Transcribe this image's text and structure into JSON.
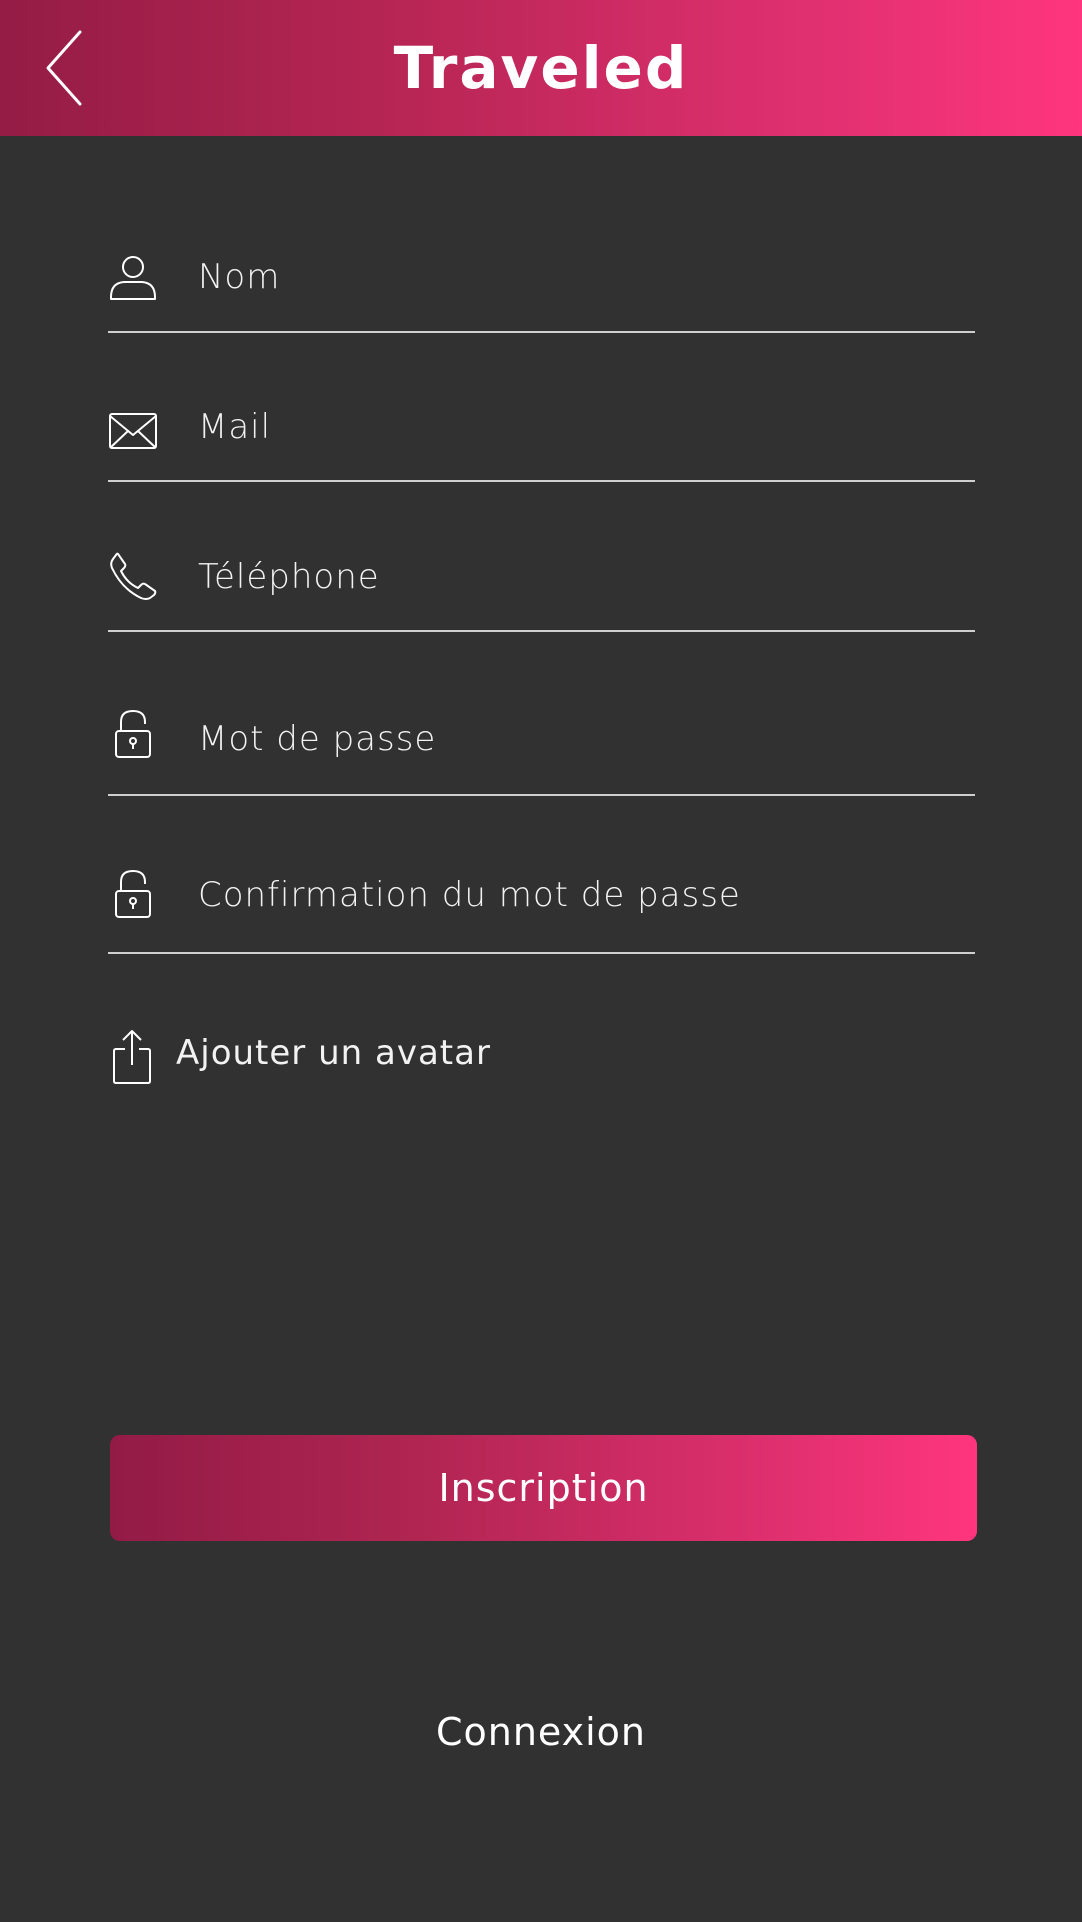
{
  "header": {
    "title": "Traveled",
    "back_icon": "chevron-left-icon"
  },
  "fields": {
    "nom": {
      "placeholder": "Nom",
      "icon": "user-icon"
    },
    "mail": {
      "placeholder": "Mail",
      "icon": "envelope-icon"
    },
    "telephone": {
      "placeholder": "Téléphone",
      "icon": "phone-icon"
    },
    "password": {
      "placeholder": "Mot de passe",
      "icon": "lock-icon"
    },
    "password_confirm": {
      "placeholder": "Confirmation du mot de passe",
      "icon": "lock-icon"
    }
  },
  "avatar": {
    "label": "Ajouter un avatar",
    "icon": "upload-icon"
  },
  "actions": {
    "signup_label": "Inscription",
    "login_label": "Connexion"
  },
  "colors": {
    "background": "#313131",
    "accent_start": "#941c45",
    "accent_end": "#ff357d",
    "text": "#ffffff",
    "divider": "#cfcfcf"
  }
}
